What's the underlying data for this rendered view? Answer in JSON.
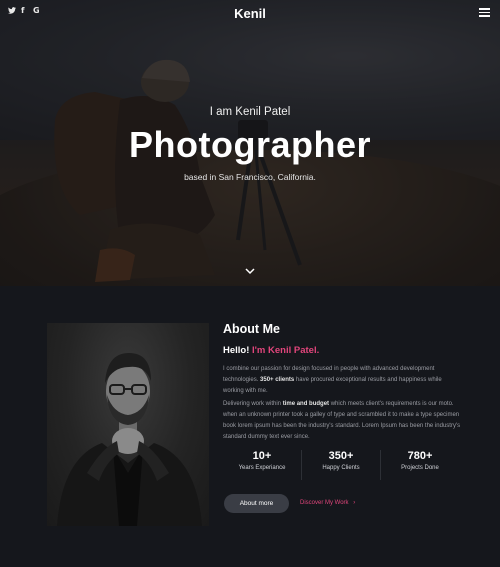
{
  "header": {
    "brand": "Kenil",
    "social_icons": [
      "twitter-icon",
      "facebook-icon",
      "google-icon"
    ],
    "social_glyphs": [
      "🐦",
      "f",
      "G"
    ]
  },
  "hero": {
    "intro": "I am Kenil Patel",
    "title": "Photographer",
    "subtitle": "based in San Francisco, California."
  },
  "about": {
    "heading": "About Me",
    "hello_prefix": "Hello!",
    "hello_name": "I'm Kenil Patel.",
    "para1_a": "I combine our passion for design focused in people with advanced development technologies.",
    "para1_b": "350+ clients",
    "para1_c": "have procured exceptional results and happiness while working with me.",
    "para2_a": "Delivering work within",
    "para2_b": "time and budget",
    "para2_c": "which meets client's requirements is our moto. when an unknown printer took a galley of type and scrambled it to make a type specimen book lorem ipsum has been the industry's standard. Lorem Ipsum has been the industry's standard dummy text ever since.",
    "stats": [
      {
        "num": "10+",
        "label": "Years Experiance"
      },
      {
        "num": "350+",
        "label": "Happy Clients"
      },
      {
        "num": "780+",
        "label": "Projects Done"
      }
    ],
    "btn_more": "About more",
    "btn_discover": "Discover My Work"
  },
  "colors": {
    "accent": "#e0457b",
    "bg": "#15171c",
    "button": "#3a3d45"
  }
}
